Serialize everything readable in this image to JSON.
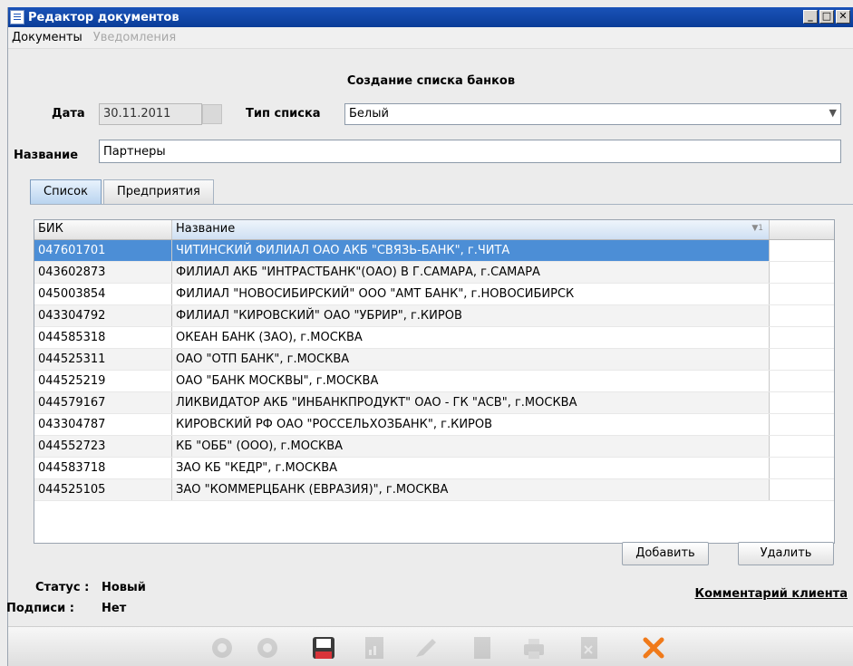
{
  "window": {
    "title": "Редактор документов"
  },
  "menu": [
    "Документы",
    "Уведомления"
  ],
  "form": {
    "title": "Создание списка банков",
    "date_label": "Дата",
    "date_value": "30.11.2011",
    "list_type_label": "Тип списка",
    "list_type_value": "Белый",
    "name_label": "Название",
    "name_value": "Партнеры"
  },
  "tabs": [
    "Список",
    "Предприятия"
  ],
  "table": {
    "headers": [
      "БИК",
      "Название"
    ],
    "sort_indicator": "1",
    "rows": [
      [
        "047601701",
        "ЧИТИНСКИЙ ФИЛИАЛ ОАО АКБ \"СВЯЗЬ-БАНК\", г.ЧИТА"
      ],
      [
        "043602873",
        "ФИЛИАЛ АКБ \"ИНТРАСТБАНК\"(ОАО) В Г.САМАРА, г.САМАРА"
      ],
      [
        "045003854",
        "ФИЛИАЛ \"НОВОСИБИРСКИЙ\" ООО \"АМТ БАНК\", г.НОВОСИБИРСК"
      ],
      [
        "043304792",
        "ФИЛИАЛ \"КИРОВСКИЙ\" ОАО \"УБРИР\", г.КИРОВ"
      ],
      [
        "044585318",
        "ОКЕАН БАНК (ЗАО), г.МОСКВА"
      ],
      [
        "044525311",
        "ОАО \"ОТП БАНК\", г.МОСКВА"
      ],
      [
        "044525219",
        "ОАО \"БАНК МОСКВЫ\", г.МОСКВА"
      ],
      [
        "044579167",
        "ЛИКВИДАТОР АКБ \"ИНБАНКПРОДУКТ\" ОАО - ГК \"АСВ\", г.МОСКВА"
      ],
      [
        "043304787",
        "КИРОВСКИЙ РФ ОАО \"РОССЕЛЬХОЗБАНК\", г.КИРОВ"
      ],
      [
        "044552723",
        "КБ \"ОББ\" (ООО), г.МОСКВА"
      ],
      [
        "044583718",
        "ЗАО КБ \"КЕДР\", г.МОСКВА"
      ],
      [
        "044525105",
        "ЗАО \"КОММЕРЦБАНК (ЕВРАЗИЯ)\", г.МОСКВА"
      ]
    ]
  },
  "buttons": {
    "add": "Добавить",
    "delete": "Удалить"
  },
  "status": {
    "status_label": "Статус :",
    "status_value": "Новый",
    "signatures_label": "Подписи :",
    "signatures_value": "Нет",
    "comment_link": "Комментарий клиента"
  },
  "colors": {
    "titlebar": "#0a3d98",
    "selection": "#4c8ed6",
    "close_accent": "#f07a1a"
  }
}
